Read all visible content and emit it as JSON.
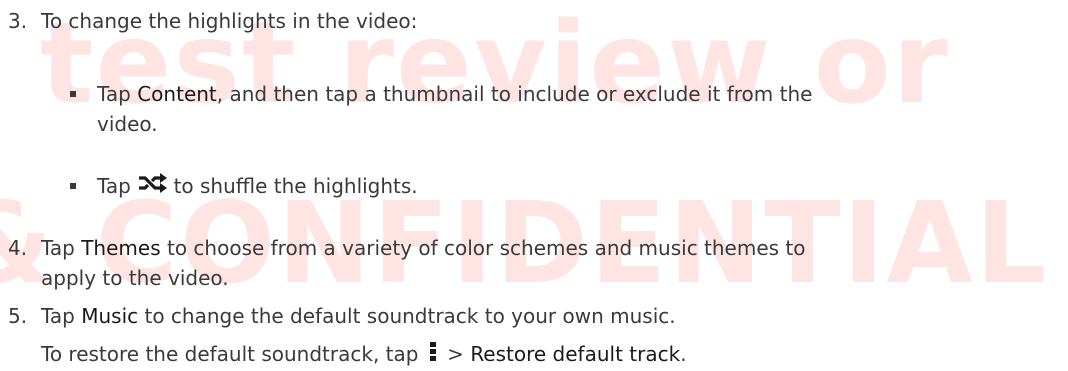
{
  "watermark": {
    "line1": "test review or",
    "line2": "& CONFIDENTIAL"
  },
  "steps": [
    {
      "number": "3.",
      "text": "To change the highlights in the video:",
      "bullets": [
        {
          "pre": "Tap ",
          "keyword": "Content",
          "post": ", and then tap a thumbnail to include or exclude it from the",
          "continuation": "video."
        },
        {
          "pre": "Tap ",
          "icon": "shuffle-icon",
          "post": " to shuffle the highlights."
        }
      ]
    },
    {
      "number": "4.",
      "pre": "Tap ",
      "keyword": "Themes",
      "post": " to choose from a variety of color schemes and music themes to",
      "continuation": "apply to the video."
    },
    {
      "number": "5.",
      "pre": "Tap ",
      "keyword": "Music",
      "post": " to change the default soundtrack to your own music.",
      "note_pre": "To restore the default soundtrack, tap ",
      "note_icon": "more-vertical-icon",
      "note_mid": " > ",
      "note_keyword": "Restore default track",
      "note_post": "."
    }
  ]
}
